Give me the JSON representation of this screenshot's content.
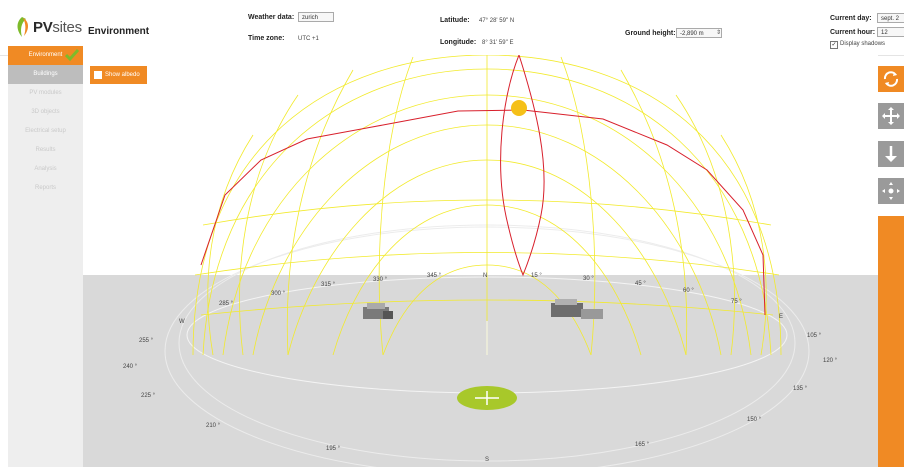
{
  "app": {
    "logo_text_bold": "PV",
    "logo_text_light": "sites"
  },
  "header": {
    "page_title": "Environment",
    "weather_label": "Weather data:",
    "weather_value": "zurich",
    "timezone_label": "Time zone:",
    "timezone_value": "UTC +1",
    "latitude_label": "Latitude:",
    "latitude_value": "47° 28' 59'' N",
    "longitude_label": "Longitude:",
    "longitude_value": "8° 31' 59'' E",
    "ground_height_label": "Ground height:",
    "ground_height_value": "-2,890 m",
    "current_day_label": "Current day:",
    "current_day_value": "sept. 2",
    "current_hour_label": "Current hour:",
    "current_hour_value": "12",
    "display_shadows_label": "Display shadows"
  },
  "sidebar": {
    "items": [
      {
        "label": "Environment"
      },
      {
        "label": "Buildings"
      },
      {
        "label": "PV modules"
      },
      {
        "label": "3D objects"
      },
      {
        "label": "Electrical setup"
      },
      {
        "label": "Results"
      },
      {
        "label": "Analysis"
      },
      {
        "label": "Reports"
      }
    ]
  },
  "viewport": {
    "show_albedo_label": "Show albedo",
    "compass": {
      "N": "N",
      "S": "S",
      "E": "E",
      "W": "W"
    },
    "azimuth_labels": [
      "345 °",
      "15 °",
      "30 °",
      "45 °",
      "60 °",
      "75 °",
      "330 °",
      "315 °",
      "300 °",
      "285 °",
      "105 °",
      "120 °",
      "135 °",
      "150 °",
      "165 °",
      "195 °",
      "210 °",
      "225 °",
      "240 °",
      "255 °"
    ]
  },
  "colors": {
    "accent": "#f08a24",
    "dome": "#f2ea2c",
    "sun_path": "#d8202c",
    "sun": "#f5c018",
    "ground": "#d9d9d9",
    "marker": "#a8c82a"
  },
  "icons": [
    "rotate-icon",
    "pan-icon",
    "move-down-icon",
    "zoom-fit-icon",
    "check-icon",
    "sun-icon"
  ]
}
